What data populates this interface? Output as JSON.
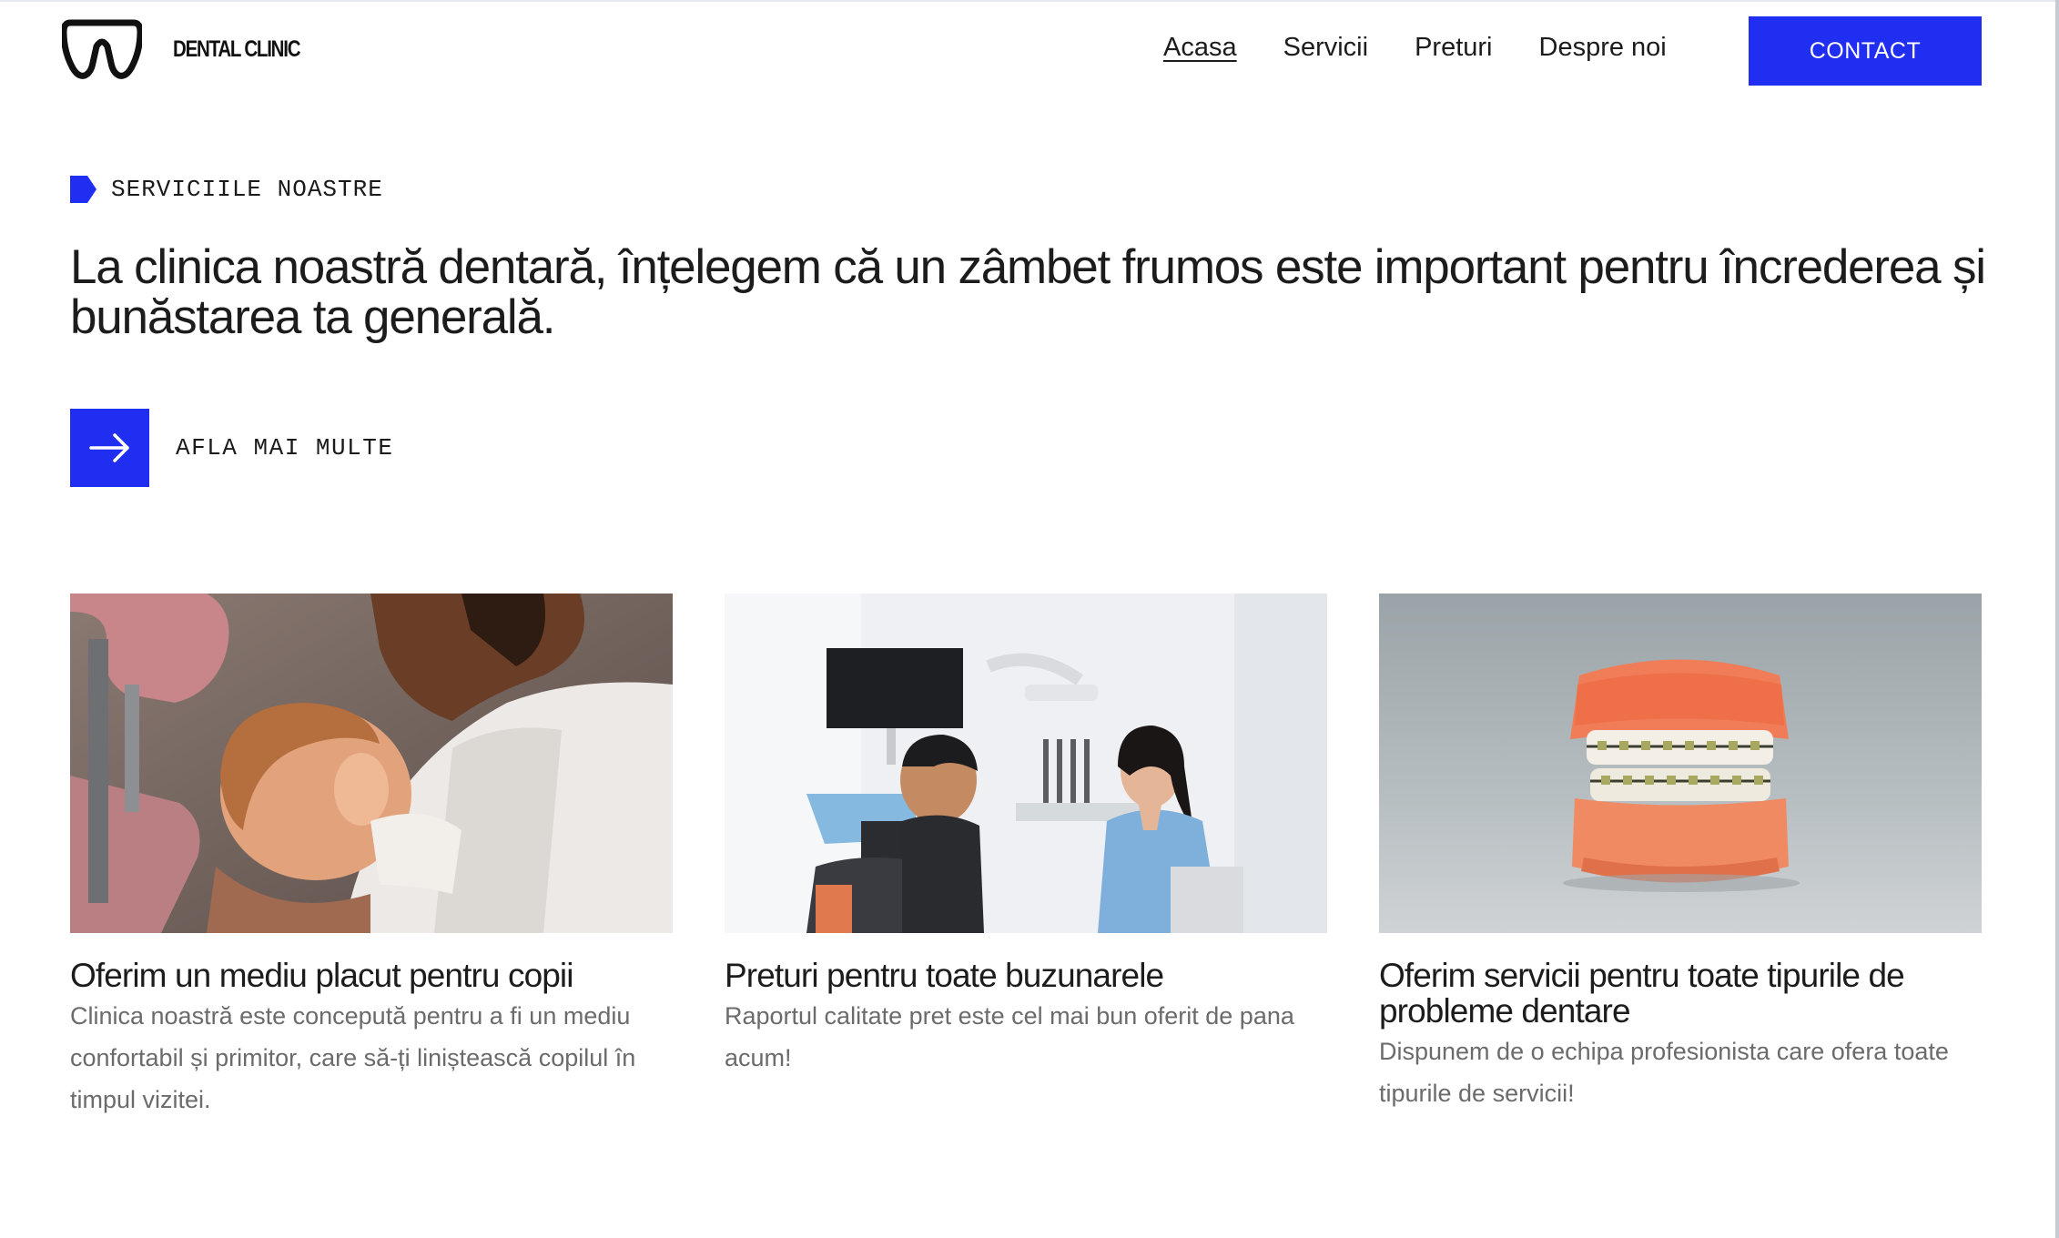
{
  "header": {
    "brand": "DENTAL CLINIC",
    "logo_icon": "tooth-logo-icon",
    "nav": [
      {
        "label": "Acasa",
        "active": true
      },
      {
        "label": "Servicii",
        "active": false
      },
      {
        "label": "Preturi",
        "active": false
      },
      {
        "label": "Despre noi",
        "active": false
      }
    ],
    "contact_label": "CONTACT"
  },
  "hero": {
    "section_label": "SERVICIILE NOASTRE",
    "headline": "La clinica noastră dentară, înțelegem că un zâmbet frumos este important pentru încrederea și bunăstarea ta generală.",
    "cta_label": "AFLA MAI MULTE",
    "cta_icon": "arrow-right-icon"
  },
  "cards": [
    {
      "image": "child-dental-checkup-photo",
      "title": "Oferim un mediu placut pentru copii",
      "text": "Clinica noastră este concepută pentru a fi un mediu confortabil și primitor, care să-ți liniștească copilul în timpul vizitei."
    },
    {
      "image": "dentist-with-patient-photo",
      "title": "Preturi pentru toate buzunarele",
      "text": "Raportul calitate pret este cel mai bun oferit de pana acum!"
    },
    {
      "image": "dental-braces-model-photo",
      "title": "Oferim servicii pentru toate tipurile de probleme dentare",
      "text": "Dispunem de o echipa profesionista care ofera toate tipurile de servicii!"
    }
  ],
  "colors": {
    "accent": "#1f2ef1",
    "text": "#1c1c1c",
    "muted": "#6b6b6b",
    "background": "#ffffff"
  }
}
